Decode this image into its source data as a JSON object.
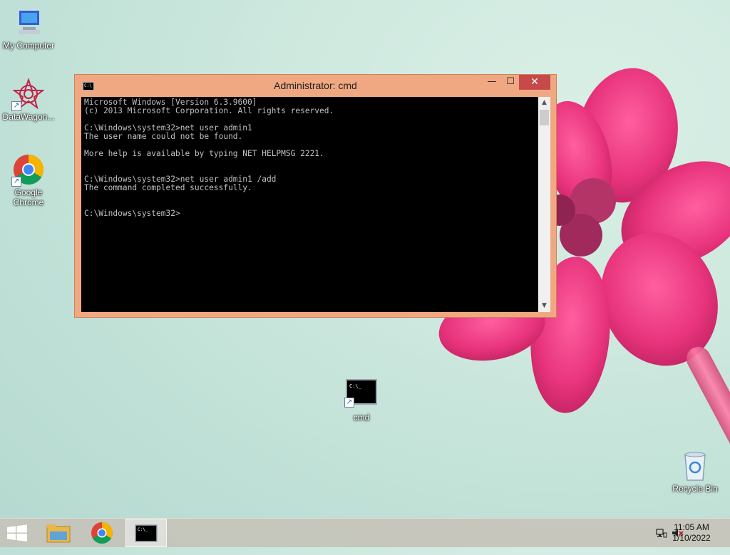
{
  "desktop": {
    "icons": [
      {
        "label": "My Computer"
      },
      {
        "label": "DataWagon..."
      },
      {
        "label": "Google Chrome"
      },
      {
        "label": "cmd"
      },
      {
        "label": "Recycle Bin"
      }
    ]
  },
  "window": {
    "title": "Administrator: cmd",
    "icon_text": "C:\\",
    "controls": {
      "minimize": "—",
      "maximize": "☐",
      "close": "✕"
    },
    "console_lines": [
      "Microsoft Windows [Version 6.3.9600]",
      "(c) 2013 Microsoft Corporation. All rights reserved.",
      "",
      "C:\\Windows\\system32>net user admin1",
      "The user name could not be found.",
      "",
      "More help is available by typing NET HELPMSG 2221.",
      "",
      "",
      "C:\\Windows\\system32>net user admin1 /add",
      "The command completed successfully.",
      "",
      "",
      "C:\\Windows\\system32>"
    ]
  },
  "taskbar": {
    "items": [
      "start-button",
      "file-explorer",
      "google-chrome",
      "cmd"
    ],
    "clock": {
      "time": "11:05 AM",
      "date": "1/10/2022"
    }
  },
  "colors": {
    "window_frame": "#f0a882",
    "close_button": "#c74a4a",
    "console_bg": "#000000",
    "console_text": "#c0c0c0"
  }
}
